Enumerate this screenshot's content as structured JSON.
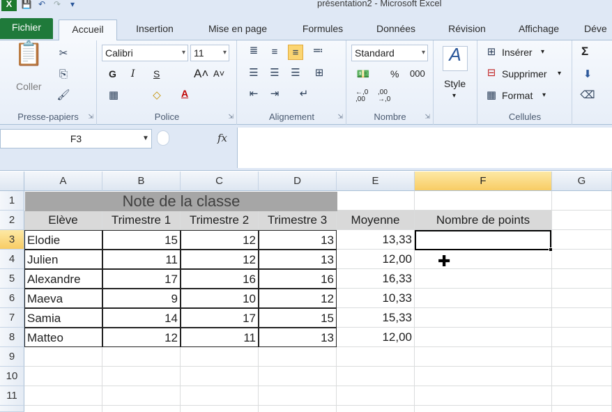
{
  "window": {
    "title": "présentation2 - Microsoft Excel"
  },
  "tabs": [
    "Fichier",
    "Accueil",
    "Insertion",
    "Mise en page",
    "Formules",
    "Données",
    "Révision",
    "Affichage",
    "Déve"
  ],
  "ribbon": {
    "clipboard": {
      "label": "Presse-papiers",
      "paste": "Coller"
    },
    "font": {
      "label": "Police",
      "name": "Calibri",
      "size": "11",
      "bold": "G",
      "italic": "I",
      "underline": "S"
    },
    "alignment": {
      "label": "Alignement"
    },
    "number": {
      "label": "Nombre",
      "format": "Standard",
      "percent": "%",
      "thousands": "000",
      "inc_dec": ",0 ,00",
      "dec_dec": ",00 ,0"
    },
    "styles": {
      "label": "Style"
    },
    "cells": {
      "label": "Cellules",
      "insert": "Insérer",
      "delete": "Supprimer",
      "format": "Format"
    }
  },
  "formula_bar": {
    "name_box": "F3",
    "fx": "fx",
    "value": ""
  },
  "columns": [
    "A",
    "B",
    "C",
    "D",
    "E",
    "F",
    "G"
  ],
  "rows": [
    "1",
    "2",
    "3",
    "4",
    "5",
    "6",
    "7",
    "8",
    "9",
    "10",
    "11"
  ],
  "sheet": {
    "title": "Note de la classe",
    "headers": [
      "Elève",
      "Trimestre 1",
      "Trimestre 2",
      "Trimestre 3",
      "Moyenne",
      "Nombre de points"
    ],
    "data": [
      [
        "Elodie",
        "15",
        "12",
        "13",
        "13,33"
      ],
      [
        "Julien",
        "11",
        "12",
        "13",
        "12,00"
      ],
      [
        "Alexandre",
        "17",
        "16",
        "16",
        "16,33"
      ],
      [
        "Maeva",
        "9",
        "10",
        "12",
        "10,33"
      ],
      [
        "Samia",
        "14",
        "17",
        "15",
        "15,33"
      ],
      [
        "Matteo",
        "12",
        "11",
        "13",
        "12,00"
      ]
    ]
  },
  "colors": {
    "fichier_tab": "#1f7a3a",
    "title_fill": "#a6a6a6",
    "header_fill": "#d9d9d9",
    "selected_header": "#f8cc64"
  }
}
